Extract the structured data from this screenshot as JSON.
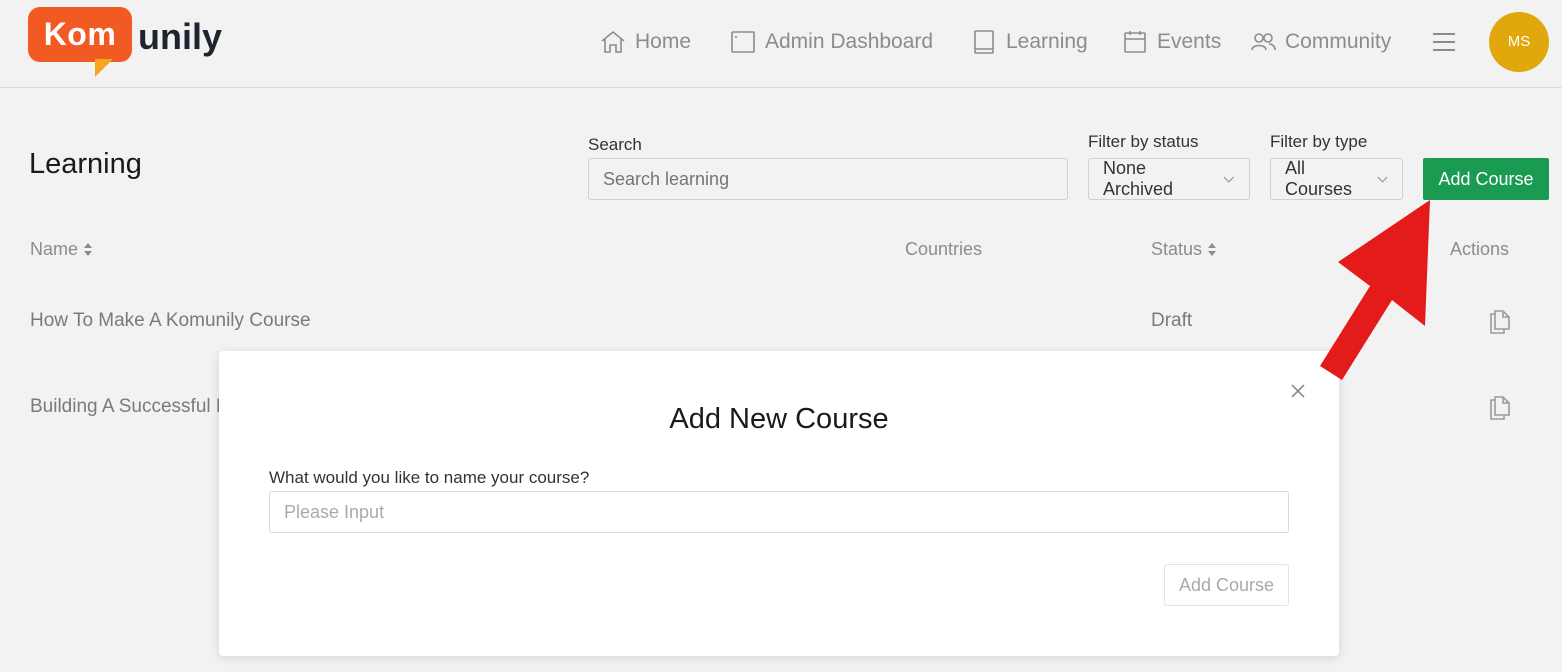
{
  "brand": {
    "logo_box": "Kom",
    "logo_rest": "unily",
    "logo_color": "#f15a22",
    "logo_tail_color": "#f6a51d"
  },
  "nav": [
    {
      "icon": "home-icon",
      "label": "Home"
    },
    {
      "icon": "window-icon",
      "label": "Admin Dashboard"
    },
    {
      "icon": "book-icon",
      "label": "Learning"
    },
    {
      "icon": "calendar-icon",
      "label": "Events"
    },
    {
      "icon": "users-icon",
      "label": "Community"
    }
  ],
  "menu_icon": "hamburger-icon",
  "user": {
    "initials": "MS",
    "avatar_color": "#e0a80c"
  },
  "page": {
    "title": "Learning"
  },
  "search": {
    "label": "Search",
    "placeholder": "Search learning"
  },
  "filters": {
    "status": {
      "label": "Filter by status",
      "value": "None Archived"
    },
    "type": {
      "label": "Filter by type",
      "value": "All Courses"
    }
  },
  "add_course_button": {
    "label": "Add Course",
    "color": "#1a9b52"
  },
  "table": {
    "columns": {
      "name": "Name",
      "countries": "Countries",
      "status": "Status",
      "actions": "Actions"
    },
    "rows": [
      {
        "name": "How To Make A Komunily Course",
        "countries": "",
        "status": "Draft",
        "action_icon": "copy-icon"
      },
      {
        "name": "Building A Successful K",
        "countries": "",
        "status": "",
        "action_icon": "copy-icon"
      }
    ]
  },
  "modal": {
    "title": "Add New Course",
    "field_label": "What would you like to name your course?",
    "input_placeholder": "Please Input",
    "input_value": "",
    "submit_label": "Add Course",
    "close_icon": "close-icon"
  },
  "annotation": {
    "arrow_color": "#e31b1b"
  }
}
